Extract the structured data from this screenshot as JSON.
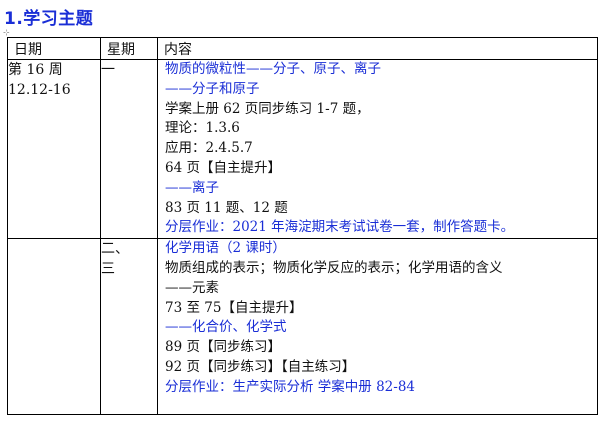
{
  "title": "1.学习主题",
  "table": {
    "headers": [
      "日期",
      "星期",
      "内容"
    ],
    "rows": [
      {
        "date": [
          "第 16 周",
          "12.12-16"
        ],
        "weekday": [
          "一"
        ],
        "content": [
          {
            "text": "物质的微粒性——分子、原子、离子",
            "color": "blue"
          },
          {
            "text": "——分子和原子",
            "color": "blue"
          },
          {
            "text": "学案上册 62 页同步练习 1-7 题，",
            "color": "black"
          },
          {
            "text": "理论：1.3.6",
            "color": "black"
          },
          {
            "text": "应用：2.4.5.7",
            "color": "black"
          },
          {
            "text": "64 页【自主提升】",
            "color": "black"
          },
          {
            "text": "——离子",
            "color": "blue"
          },
          {
            "text": "83 页 11 题、12 题",
            "color": "black"
          },
          {
            "text": "分层作业：2021 年海淀期末考试试卷一套，制作答题卡。",
            "color": "blue"
          }
        ]
      },
      {
        "date": [],
        "weekday": [
          "二、",
          "三"
        ],
        "content": [
          {
            "text": "化学用语（2 课时）",
            "color": "blue"
          },
          {
            "text": "物质组成的表示；物质化学反应的表示；化学用语的含义",
            "color": "black"
          },
          {
            "text": "——元素",
            "color": "black"
          },
          {
            "text": "73 至 75【自主提升】",
            "color": "black"
          },
          {
            "text": "——化合价、化学式",
            "color": "blue"
          },
          {
            "text": "89 页【同步练习】",
            "color": "black"
          },
          {
            "text": "92 页【同步练习】【自主练习】",
            "color": "black"
          },
          {
            "text": "分层作业：生产实际分析      学案中册 82-84",
            "color": "blue"
          }
        ]
      }
    ]
  },
  "colors": {
    "accent": "#1a2ed6",
    "text": "#111111"
  }
}
